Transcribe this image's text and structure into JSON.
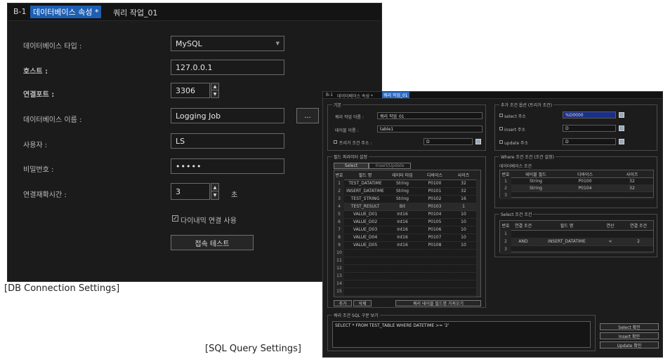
{
  "db_panel": {
    "tabs": [
      {
        "label": "B-1"
      },
      {
        "label": "데이터베이스 속성 *"
      },
      {
        "label": "쿼리 작업_01"
      }
    ],
    "fields": {
      "db_type": {
        "label": "데이터베이스 타입 :",
        "value": "MySQL"
      },
      "host": {
        "label": "호스트 :",
        "value": "127.0.0.1"
      },
      "port": {
        "label": "연결포트 :",
        "value": "3306"
      },
      "db_name": {
        "label": "데이터베이스 이름 :",
        "value": "Logging Job",
        "browse_label": "..."
      },
      "user": {
        "label": "사용자 :",
        "value": "LS"
      },
      "password": {
        "label": "비밀번호 :",
        "value": "•••••"
      },
      "reconnect": {
        "label": "연결재확시간 :",
        "value": "3",
        "unit": "초"
      }
    },
    "checkbox": {
      "label": "다이내믹 연결 사용",
      "checked": true
    },
    "test_button": "접속 테스트"
  },
  "captions": {
    "db": "[DB Connection Settings]",
    "sql": "[SQL Query Settings]"
  },
  "sql_panel": {
    "tabs": [
      {
        "label": "B-1"
      },
      {
        "label": "데이터베이스 속성 *"
      },
      {
        "label": "쿼리 작업_01"
      }
    ],
    "basic": {
      "title": "기본",
      "query_name_label": "쿼리 작업 이름 :",
      "query_name_value": "쿼리 작업_01",
      "table_label": "테이블 이름 :",
      "table_value": "table1",
      "trigger_label": "트리거 조건 주소 :",
      "trigger_value": "D"
    },
    "extra": {
      "title": "추가 조건 옵션 (트리거 조건)",
      "rows": [
        {
          "label": "select 주소",
          "value": "%D0000"
        },
        {
          "label": "insert 주소",
          "value": "D"
        },
        {
          "label": "update 주소",
          "value": "D"
        }
      ]
    },
    "field_set": {
      "title": "필드 파라미터 설정",
      "tabs": [
        "Select",
        "Insert/Update"
      ],
      "headers": [
        "번호",
        "필드 명",
        "데이터 타입",
        "디바이스",
        "사이즈"
      ],
      "rows": [
        [
          "1",
          "TEST_DATATIME",
          "String",
          "P0100",
          "32"
        ],
        [
          "2",
          "INSERT_DATATIME",
          "String",
          "P0101",
          "32"
        ],
        [
          "3",
          "TEST_STRING",
          "String",
          "P0102",
          "16"
        ],
        [
          "4",
          "TEST_RESULT",
          "Bit",
          "P0103",
          "1"
        ],
        [
          "5",
          "VALUE_D01",
          "Int16",
          "P0104",
          "10"
        ],
        [
          "6",
          "VALUE_D02",
          "Int16",
          "P0105",
          "10"
        ],
        [
          "7",
          "VALUE_D03",
          "Int16",
          "P0106",
          "10"
        ],
        [
          "8",
          "VALUE_D04",
          "Int16",
          "P0107",
          "10"
        ],
        [
          "9",
          "VALUE_D05",
          "Int16",
          "P0108",
          "10"
        ],
        [
          "10",
          "",
          "",
          "",
          ""
        ],
        [
          "11",
          "",
          "",
          "",
          ""
        ],
        [
          "12",
          "",
          "",
          "",
          ""
        ],
        [
          "13",
          "",
          "",
          "",
          ""
        ],
        [
          "14",
          "",
          "",
          "",
          ""
        ],
        [
          "15",
          "",
          "",
          "",
          ""
        ]
      ],
      "buttons": [
        "추가",
        "삭제",
        "쿼리 테이블 필드명 가져오기"
      ]
    },
    "where_set": {
      "title": "Where 조건 조건 (조건 설정)",
      "subtitle": "데이터베이스 조건",
      "headers": [
        "번호",
        "테이블 필드",
        "디바이스",
        "사이즈"
      ],
      "rows": [
        [
          "1",
          "String",
          "P0100",
          "32"
        ],
        [
          "2",
          "String",
          "P0104",
          "32"
        ],
        [
          "3",
          "",
          "",
          ""
        ]
      ]
    },
    "order_set": {
      "title": "Select 조건 조건",
      "headers": [
        "번호",
        "연결 조건",
        "필드 명",
        "연산",
        "연결 조건"
      ],
      "rows": [
        [
          "1",
          "",
          "",
          "",
          ""
        ],
        [
          "2",
          "AND",
          "INSERT_DATATIME",
          "<",
          "2"
        ],
        [
          "3",
          "",
          "",
          "",
          ""
        ]
      ]
    },
    "query": {
      "title": "쿼리 조건 SQL 구문 보기",
      "text": "SELECT * FROM TEST_TABLE WHERE DATETIME >= '2'"
    },
    "side_buttons": [
      "Select 확인",
      "Insert 확인",
      "Update 확인"
    ]
  }
}
